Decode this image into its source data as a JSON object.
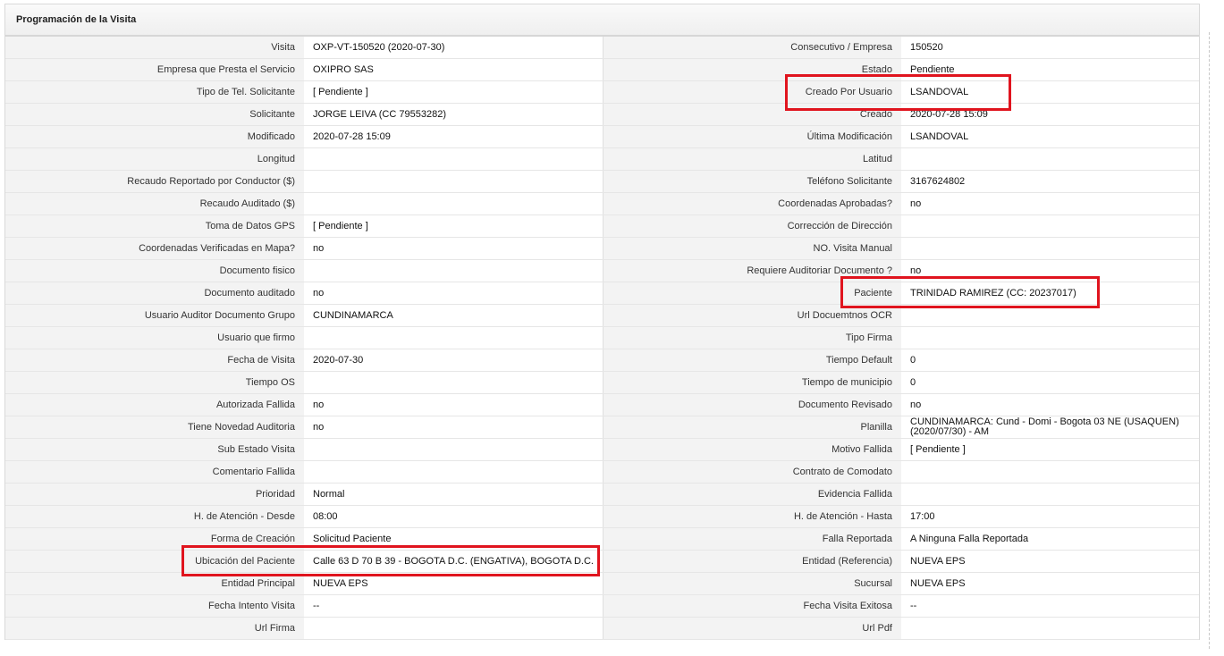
{
  "panel": {
    "title": "Programación de la Visita"
  },
  "rows": [
    [
      "Visita",
      "OXP-VT-150520 (2020-07-30)",
      "Consecutivo / Empresa",
      "150520"
    ],
    [
      "Empresa que Presta el Servicio",
      "OXIPRO SAS",
      "Estado",
      "Pendiente"
    ],
    [
      "Tipo de Tel. Solicitante",
      "[ Pendiente ]",
      "Creado Por Usuario",
      "LSANDOVAL"
    ],
    [
      "Solicitante",
      "JORGE LEIVA (CC 79553282)",
      "Creado",
      "2020-07-28 15:09"
    ],
    [
      "Modificado",
      "2020-07-28 15:09",
      "Última Modificación",
      " LSANDOVAL"
    ],
    [
      "Longitud",
      "",
      "Latitud",
      ""
    ],
    [
      "Recaudo Reportado por Conductor ($)",
      "",
      "Teléfono Solicitante",
      "3167624802"
    ],
    [
      "Recaudo Auditado ($)",
      "",
      "Coordenadas Aprobadas?",
      " no"
    ],
    [
      "Toma de Datos GPS",
      "[ Pendiente ]",
      "Corrección de Dirección",
      ""
    ],
    [
      "Coordenadas Verificadas en Mapa?",
      " no",
      "NO. Visita Manual",
      ""
    ],
    [
      "Documento fisico",
      "",
      "Requiere Auditoriar Documento ?",
      " no"
    ],
    [
      "Documento auditado",
      " no",
      "Paciente",
      "TRINIDAD RAMIREZ (CC: 20237017)"
    ],
    [
      "Usuario Auditor Documento Grupo",
      "CUNDINAMARCA",
      "Url Docuemtnos OCR",
      ""
    ],
    [
      "Usuario que firmo",
      "",
      "Tipo Firma",
      ""
    ],
    [
      "Fecha de Visita",
      " 2020-07-30",
      "Tiempo Default",
      "0"
    ],
    [
      "Tiempo OS",
      "",
      "Tiempo de municipio",
      "0"
    ],
    [
      "Autorizada Fallida",
      " no",
      "Documento Revisado",
      " no"
    ],
    [
      "Tiene Novedad Auditoria",
      " no",
      "Planilla",
      "CUNDINAMARCA: Cund - Domi - Bogota 03 NE (USAQUEN) (2020/07/30) - AM"
    ],
    [
      "Sub Estado Visita",
      "",
      "Motivo Fallida",
      "[ Pendiente ]"
    ],
    [
      "Comentario Fallida",
      "",
      "Contrato de Comodato",
      ""
    ],
    [
      "Prioridad",
      "Normal",
      "Evidencia Fallida",
      ""
    ],
    [
      "H. de Atención - Desde",
      "08:00",
      "H. de Atención - Hasta",
      "17:00"
    ],
    [
      "Forma de Creación",
      "Solicitud Paciente",
      "Falla Reportada",
      "A Ninguna Falla Reportada"
    ],
    [
      "Ubicación del Paciente",
      "Calle 63 D 70 B 39 - BOGOTA D.C. (ENGATIVA), BOGOTA D.C.",
      "Entidad (Referencia)",
      "NUEVA EPS"
    ],
    [
      "Entidad Principal",
      "NUEVA EPS",
      "Sucursal",
      "NUEVA EPS"
    ],
    [
      "Fecha Intento Visita",
      " --",
      "Fecha Visita Exitosa",
      " --"
    ],
    [
      "Url Firma",
      "",
      "Url Pdf",
      ""
    ]
  ],
  "highlight_color": "#e0141e"
}
